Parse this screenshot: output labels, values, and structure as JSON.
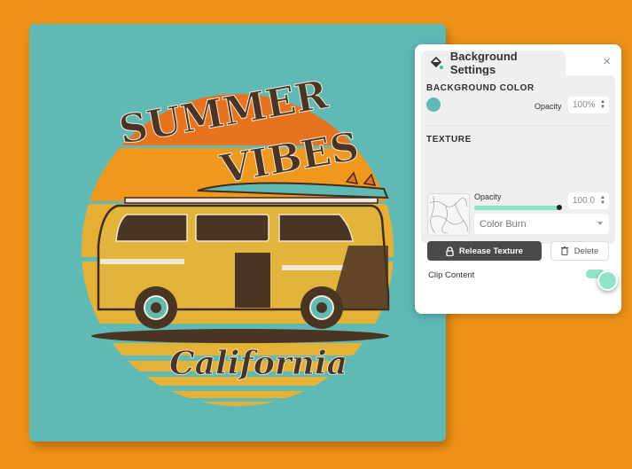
{
  "artwork": {
    "headline_top": "SUMMER",
    "headline_bottom": "VIBES",
    "script_text": "California"
  },
  "colors": {
    "page_background": "#EE9217",
    "canvas_background": "#5FBAB6",
    "accent_mint": "#8FE3C9",
    "dark_button": "#4A4A4A"
  },
  "panel": {
    "title": "Background Settings",
    "close_icon": "×",
    "background_color": {
      "section_title": "BACKGROUND COLOR",
      "swatch_color": "#5FBAB6",
      "opacity_label": "Opacity",
      "opacity_value": "100%"
    },
    "texture": {
      "section_title": "TEXTURE",
      "opacity_label": "Opacity",
      "opacity_value": "100.0",
      "opacity_slider_percent": 100,
      "blend_mode": "Color Burn",
      "release_button": "Release Texture",
      "delete_button": "Delete"
    },
    "clip_content": {
      "label": "Clip Content",
      "enabled": true
    }
  }
}
